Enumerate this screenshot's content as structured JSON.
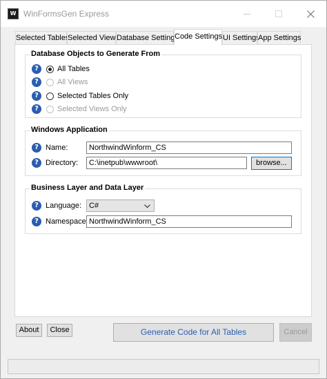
{
  "window": {
    "title": "WinFormsGen Express",
    "icon_glyph": "W"
  },
  "tabs": [
    {
      "label": "Selected Tables",
      "active": false
    },
    {
      "label": "Selected Views",
      "active": false
    },
    {
      "label": "Database Settings",
      "active": false
    },
    {
      "label": "Code Settings",
      "active": true
    },
    {
      "label": "UI Settings",
      "active": false
    },
    {
      "label": "App Settings",
      "active": false
    }
  ],
  "db_objects": {
    "title": "Database Objects to Generate From",
    "options": [
      {
        "label": "All Tables",
        "checked": true,
        "enabled": true
      },
      {
        "label": "All Views",
        "checked": false,
        "enabled": false
      },
      {
        "label": "Selected Tables Only",
        "checked": false,
        "enabled": true
      },
      {
        "label": "Selected Views Only",
        "checked": false,
        "enabled": false
      }
    ]
  },
  "windows_app": {
    "title": "Windows Application",
    "name_label": "Name:",
    "name_value": "NorthwindWinform_CS",
    "directory_label": "Directory:",
    "directory_value": "C:\\inetpub\\wwwroot\\",
    "browse_label": "browse..."
  },
  "business_layer": {
    "title": "Business Layer and Data Layer",
    "language_label": "Language:",
    "language_value": "C#",
    "namespace_label": "Namespace:",
    "namespace_value": "NorthwindWinform_CS"
  },
  "footer": {
    "about_label": "About",
    "close_label": "Close",
    "generate_label": "Generate Code for All Tables",
    "cancel_label": "Cancel"
  },
  "help_glyph": "?",
  "colors": {
    "help_icon": "#2a5db0",
    "generate_text": "#2a5db0",
    "focus_border": "#0078d7"
  }
}
